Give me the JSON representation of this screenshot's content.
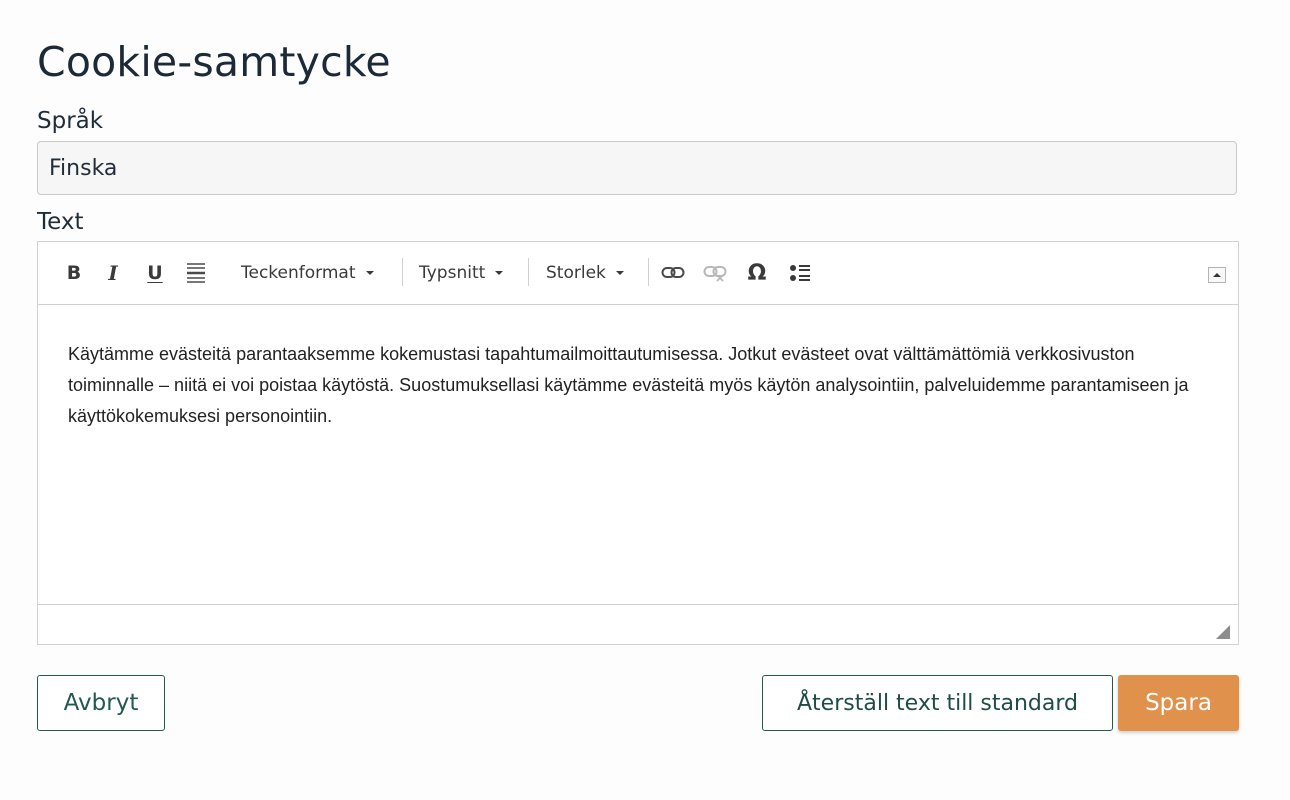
{
  "page": {
    "title": "Cookie-samtycke"
  },
  "language": {
    "label": "Språk",
    "value": "Finska"
  },
  "text_field": {
    "label": "Text"
  },
  "toolbar": {
    "bold": "B",
    "italic": "I",
    "underline": "U",
    "format_combo": "Teckenformat",
    "font_combo": "Typsnitt",
    "size_combo": "Storlek",
    "special_char": "Ω"
  },
  "editor": {
    "content": "Käytämme evästeitä parantaaksemme kokemustasi tapahtumailmoittautumisessa. Jotkut evästeet ovat välttämättömiä verkkosivuston toiminnalle – niitä ei voi poistaa käytöstä. Suostumuksellasi käytämme evästeitä myös käytön analysointiin, palveluidemme parantamiseen ja käyttökokemuksesi personointiin."
  },
  "actions": {
    "cancel": "Avbryt",
    "reset": "Återställ text till standard",
    "save": "Spara"
  },
  "colors": {
    "accent": "#e0914b",
    "primary": "#235a4f",
    "title": "#1c2a38"
  }
}
